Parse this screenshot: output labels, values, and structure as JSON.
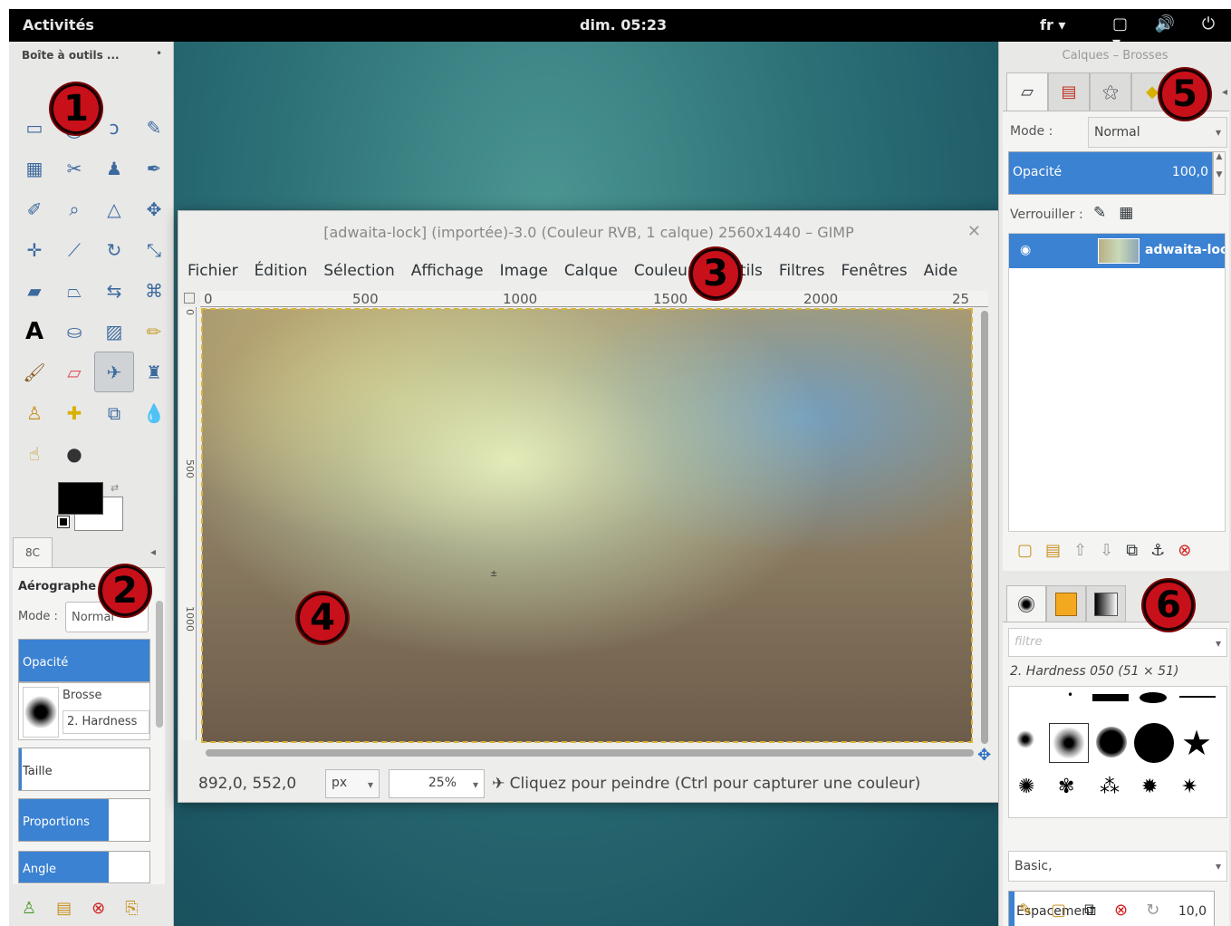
{
  "topbar": {
    "activities": "Activités",
    "clock": "dim. 05:23",
    "lang": "fr ▾",
    "system_icons": "▢ 🔊 ⏻ ▾"
  },
  "toolbox": {
    "title": "Boîte à outils ...",
    "tab_label": "8C",
    "options": {
      "heading": "Aérographe",
      "mode_label": "Mode :",
      "mode_value": "Normal",
      "opacity_label": "Opacité",
      "brush_label": "Brosse",
      "brush_value": "2. Hardness",
      "size_label": "Taille",
      "proportions_label": "Proportions",
      "angle_label": "Angle"
    }
  },
  "image_window": {
    "title": "[adwaita-lock] (importée)-3.0 (Couleur RVB, 1 calque) 2560x1440 – GIMP",
    "menu": [
      "Fichier",
      "Édition",
      "Sélection",
      "Affichage",
      "Image",
      "Calque",
      "Couleurs",
      "Outils",
      "Filtres",
      "Fenêtres",
      "Aide"
    ],
    "ruler_h": [
      "0",
      "500",
      "1000",
      "1500",
      "2000",
      "25"
    ],
    "ruler_v": [
      "0",
      "500",
      "1000"
    ],
    "status": {
      "coords": "892,0, 552,0",
      "unit": "px",
      "zoom": "25%",
      "message": "Cliquez pour peindre (Ctrl pour capturer une couleur)"
    }
  },
  "dock": {
    "title": "Calques – Brosses",
    "layers": {
      "mode_label": "Mode :",
      "mode_value": "Normal",
      "opacity_label": "Opacité",
      "opacity_value": "100,0",
      "lock_label": "Verrouiller :",
      "layer_name": "adwaita-lock"
    },
    "brushes": {
      "filter_placeholder": "filtre",
      "selected_brush": "2. Hardness 050 (51 × 51)",
      "set": "Basic,",
      "spacing_label": "Espacement",
      "spacing_value": "10,0"
    }
  },
  "markers": [
    "1",
    "2",
    "3",
    "4",
    "5",
    "6"
  ],
  "colors": {
    "accent": "#3b82d2",
    "marker": "#c8101a",
    "desktop": "#2e7378"
  }
}
